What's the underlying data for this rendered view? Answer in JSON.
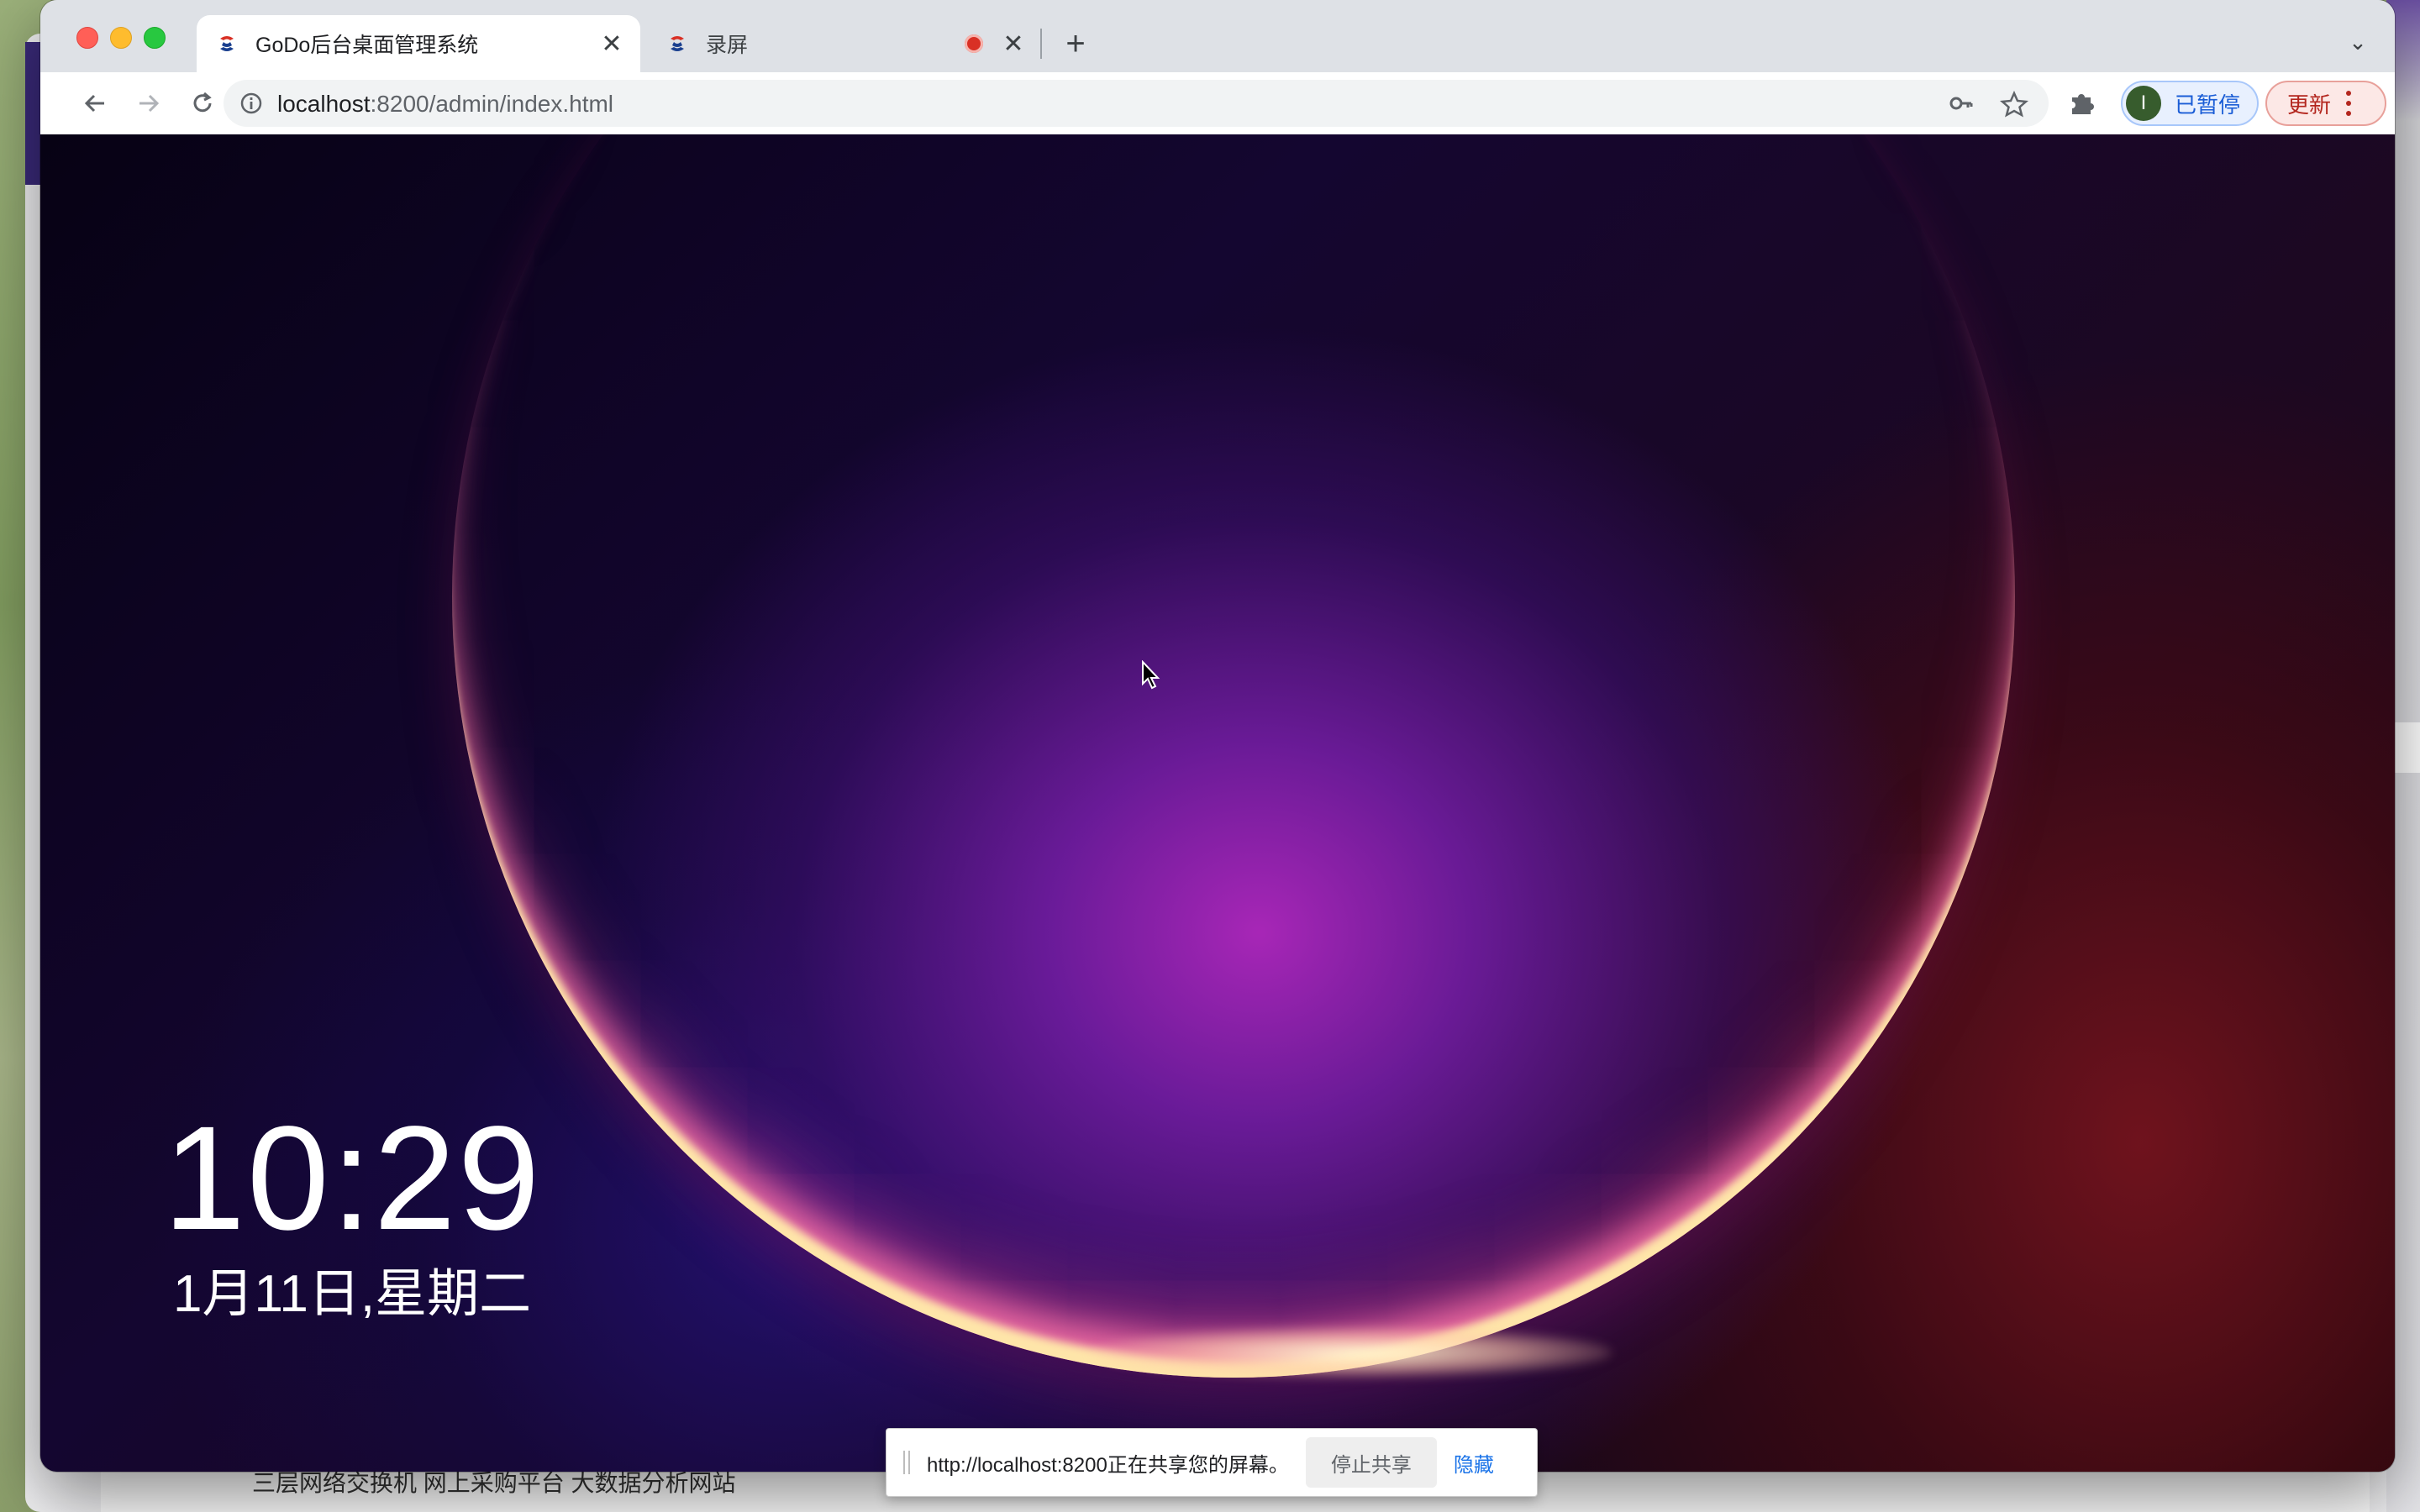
{
  "browser": {
    "tabs": [
      {
        "title": "GoDo后台桌面管理系统",
        "active": true,
        "favicon": "godo-logo-icon"
      },
      {
        "title": "录屏",
        "active": false,
        "favicon": "godo-logo-icon",
        "recording": true
      }
    ],
    "url_host": "localhost",
    "url_path": ":8200/admin/index.html",
    "profile_initial": "I",
    "profile_label": "已暂停",
    "update_label": "更新"
  },
  "lock_screen": {
    "time": "10:29",
    "date": "1月11日,星期二"
  },
  "share_bar": {
    "message": "http://localhost:8200正在共享您的屏幕。",
    "stop_label": "停止共享",
    "hide_label": "隐藏"
  },
  "background_page": {
    "bottom_text": "三层网络交换机   网上采购平台   大数据分析网站"
  },
  "colors": {
    "accent_blue": "#1a73e8",
    "update_red": "#b3261e",
    "tab_bar": "#dee1e6"
  }
}
